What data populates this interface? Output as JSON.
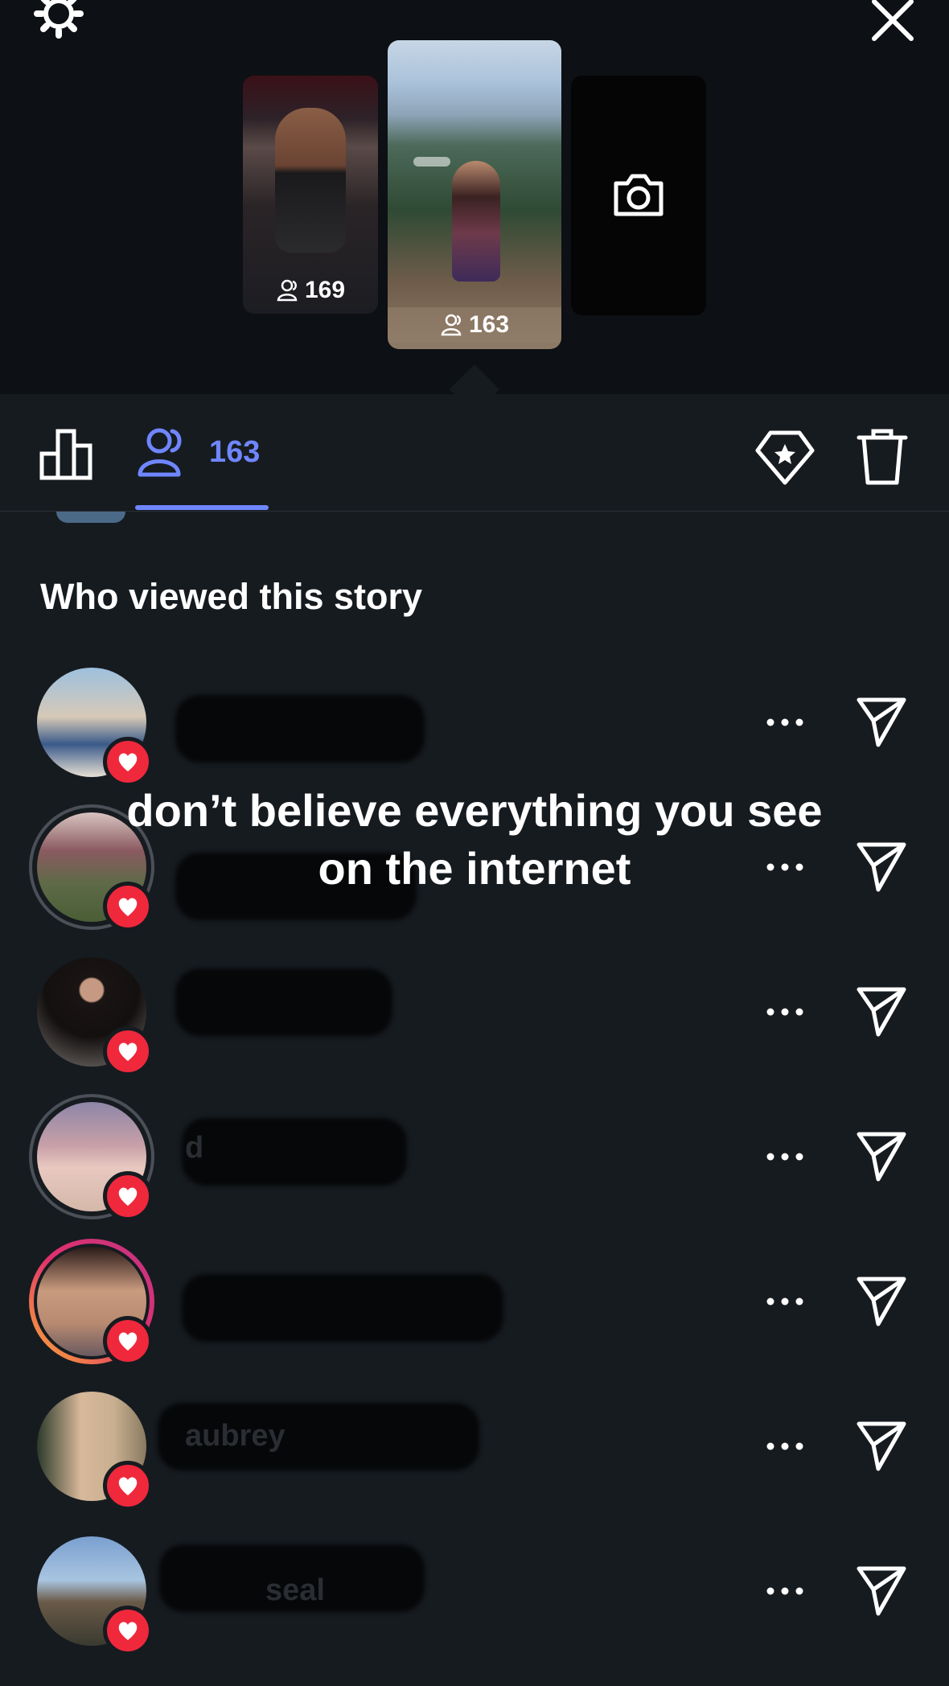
{
  "header": {
    "stories": [
      {
        "viewer_count": "169"
      },
      {
        "viewer_count": "163"
      },
      {
        "viewer_count": ""
      }
    ]
  },
  "toolbar": {
    "viewers_count": "163"
  },
  "section_title": "Who viewed this story",
  "caption": "don’t believe everything you see on the internet",
  "viewers": [
    {
      "username": "",
      "liked": true
    },
    {
      "username": "",
      "liked": true
    },
    {
      "username": "",
      "liked": true
    },
    {
      "username": "d",
      "liked": true
    },
    {
      "username": "",
      "liked": true
    },
    {
      "username": "aubrey",
      "liked": true
    },
    {
      "username": "seal",
      "liked": true
    }
  ],
  "colors": {
    "accent": "#6f86ff",
    "heart": "#f0283c",
    "background": "#161b20"
  }
}
